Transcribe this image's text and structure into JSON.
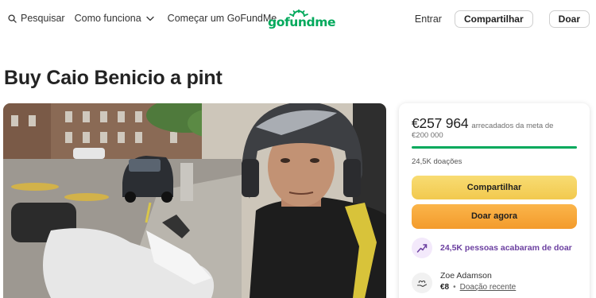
{
  "nav": {
    "search_label": "Pesquisar",
    "how_it_works_label": "Como funciona",
    "start_label": "Começar um GoFundMe",
    "logo_text": "gofundme",
    "signin_label": "Entrar",
    "share_label": "Compartilhar",
    "donate_label": "Doar"
  },
  "campaign": {
    "title": "Buy Caio Benicio a pint"
  },
  "card": {
    "raised_amount": "€257 964",
    "raised_label": "arrecadados da meta de",
    "goal_amount": "€200 000",
    "progress_fraction": 1.0,
    "donations_count": "24,5K doações",
    "share_button": "Compartilhar",
    "donate_button": "Doar agora",
    "activity_text": "24,5K pessoas acabaram de doar",
    "recent_donor": {
      "name": "Zoe Adamson",
      "amount": "€8",
      "separator": "•",
      "tag": "Doação recente"
    }
  },
  "colors": {
    "brand_green": "#02a95c",
    "share_yellow": "#f2c94e",
    "donate_orange": "#f39b2c",
    "activity_purple": "#6b3fa0"
  },
  "icons": [
    "search-icon",
    "chevron-down-icon",
    "trend-up-icon",
    "hand-heart-icon"
  ]
}
